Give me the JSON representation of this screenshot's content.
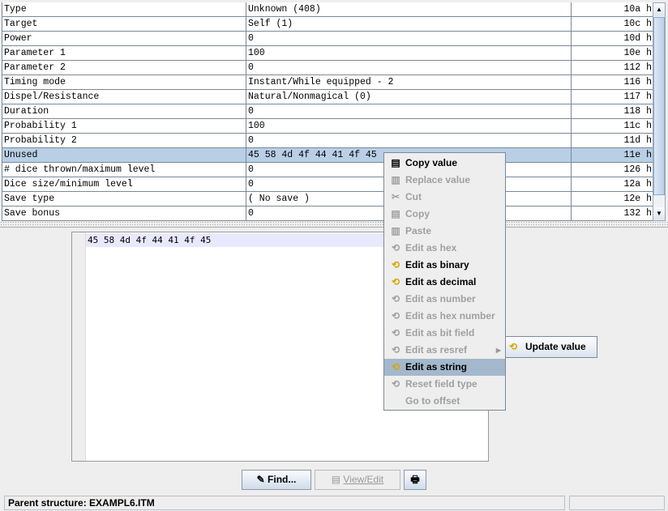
{
  "table": {
    "rows": [
      {
        "name": "Type",
        "value": "Unknown (408)",
        "offset": "10a h"
      },
      {
        "name": "Target",
        "value": "Self (1)",
        "offset": "10c h"
      },
      {
        "name": "Power",
        "value": "0",
        "offset": "10d h"
      },
      {
        "name": "Parameter 1",
        "value": "100",
        "offset": "10e h"
      },
      {
        "name": "Parameter 2",
        "value": "0",
        "offset": "112 h"
      },
      {
        "name": "Timing mode",
        "value": "Instant/While equipped - 2",
        "offset": "116 h"
      },
      {
        "name": "Dispel/Resistance",
        "value": "Natural/Nonmagical (0)",
        "offset": "117 h"
      },
      {
        "name": "Duration",
        "value": "0",
        "offset": "118 h"
      },
      {
        "name": "Probability 1",
        "value": "100",
        "offset": "11c h"
      },
      {
        "name": "Probability 2",
        "value": "0",
        "offset": "11d h"
      },
      {
        "name": "Unused",
        "value": "45 58 4d 4f 44 41 4f 45",
        "offset": "11e h",
        "selected": true
      },
      {
        "name": "# dice thrown/maximum level",
        "value": "0",
        "offset": "126 h"
      },
      {
        "name": "Dice size/minimum level",
        "value": "0",
        "offset": "12a h"
      },
      {
        "name": "Save type",
        "value": "( No save )",
        "offset": "12e h"
      },
      {
        "name": "Save bonus",
        "value": "0",
        "offset": "132 h"
      }
    ]
  },
  "editor": {
    "text": "45 58 4d 4f 44 41 4f 45"
  },
  "context_menu": {
    "items": [
      {
        "label": "Copy value",
        "icon": "copy-icon",
        "enabled": true
      },
      {
        "label": "Replace value",
        "icon": "paste-icon",
        "enabled": false
      },
      {
        "label": "Cut",
        "icon": "scissors-icon",
        "enabled": false
      },
      {
        "label": "Copy",
        "icon": "copy-icon",
        "enabled": false
      },
      {
        "label": "Paste",
        "icon": "paste-icon",
        "enabled": false
      },
      {
        "label": "Edit as hex",
        "icon": "refresh-icon",
        "enabled": false
      },
      {
        "label": "Edit as binary",
        "icon": "refresh-icon",
        "enabled": true
      },
      {
        "label": "Edit as decimal",
        "icon": "refresh-icon",
        "enabled": true
      },
      {
        "label": "Edit as number",
        "icon": "refresh-icon",
        "enabled": false
      },
      {
        "label": "Edit as hex number",
        "icon": "refresh-icon",
        "enabled": false
      },
      {
        "label": "Edit as bit field",
        "icon": "refresh-icon",
        "enabled": false
      },
      {
        "label": "Edit as resref",
        "icon": "refresh-icon",
        "enabled": false,
        "submenu": true
      },
      {
        "label": "Edit as string",
        "icon": "refresh-icon",
        "enabled": true,
        "highlighted": true
      },
      {
        "label": "Reset field type",
        "icon": "refresh-icon",
        "enabled": false
      },
      {
        "label": "Go to offset",
        "icon": "",
        "enabled": false
      }
    ]
  },
  "update_button": {
    "label": "Update value"
  },
  "buttons": {
    "find": "Find...",
    "view_edit": "View/Edit"
  },
  "status": {
    "left": "Parent structure: EXAMPL6.ITM",
    "right": ""
  }
}
